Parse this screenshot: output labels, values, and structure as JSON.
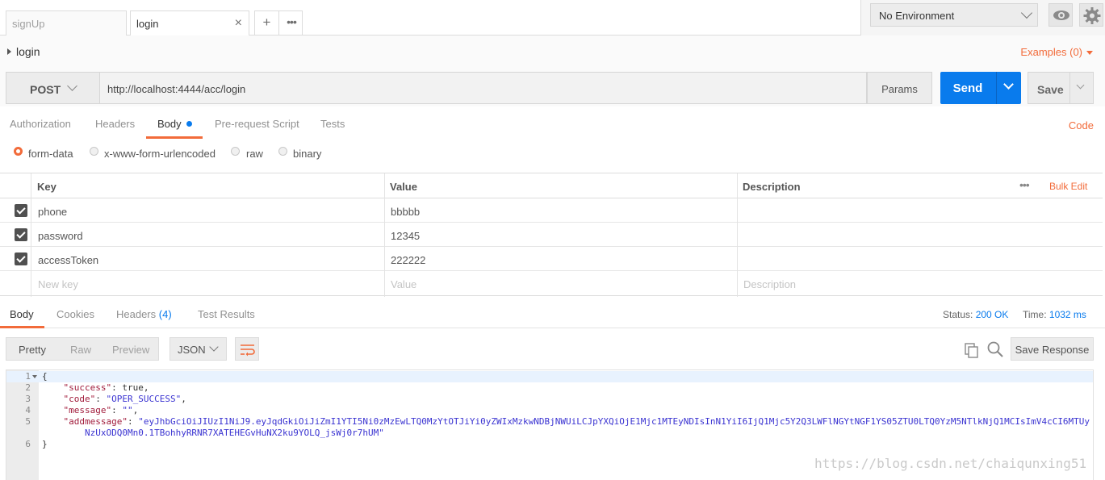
{
  "tabs": [
    {
      "label": "signUp"
    },
    {
      "label": "login"
    }
  ],
  "tab_close_glyph": "×",
  "tab_add_glyph": "+",
  "tab_more_glyph": "•••",
  "environment": {
    "selected": "No Environment"
  },
  "request": {
    "name": "login",
    "examples_label": "Examples (0)",
    "method": "POST",
    "url": "http://localhost:4444/acc/login",
    "params_label": "Params",
    "send_label": "Send",
    "save_label": "Save"
  },
  "request_tabs": {
    "items": [
      "Authorization",
      "Headers",
      "Body",
      "Pre-request Script",
      "Tests"
    ],
    "active": "Body",
    "code_label": "Code"
  },
  "body_types": {
    "options": [
      "form-data",
      "x-www-form-urlencoded",
      "raw",
      "binary"
    ],
    "selected": "form-data"
  },
  "kv_table": {
    "headers": {
      "key": "Key",
      "value": "Value",
      "description": "Description"
    },
    "bulk_edit": "Bulk Edit",
    "more_glyph": "•••",
    "rows": [
      {
        "checked": true,
        "key": "phone",
        "value": "bbbbb",
        "description": ""
      },
      {
        "checked": true,
        "key": "password",
        "value": "12345",
        "description": ""
      },
      {
        "checked": true,
        "key": "accessToken",
        "value": "222222",
        "description": ""
      }
    ],
    "placeholder": {
      "key": "New key",
      "value": "Value",
      "description": "Description"
    }
  },
  "response_tabs": {
    "body": "Body",
    "cookies": "Cookies",
    "headers": "Headers",
    "headers_count": "(4)",
    "test_results": "Test Results",
    "active": "Body"
  },
  "response_status": {
    "status_label": "Status:",
    "status_value": "200 OK",
    "time_label": "Time:",
    "time_value": "1032 ms"
  },
  "response_toolbar": {
    "views": [
      "Pretty",
      "Raw",
      "Preview"
    ],
    "active_view": "Pretty",
    "format": "JSON",
    "save_response": "Save Response"
  },
  "response_body": {
    "line_numbers": [
      "1",
      "2",
      "3",
      "4",
      "5",
      "",
      "6"
    ],
    "open_brace": "{",
    "close_brace": "}",
    "success_key": "\"success\"",
    "success_value": "true",
    "code_key": "\"code\"",
    "code_value": "\"OPER_SUCCESS\"",
    "message_key": "\"message\"",
    "message_value": "\"\"",
    "addmessage_key": "\"addmessage\"",
    "addmessage_value_line1": "\"eyJhbGciOiJIUzI1NiJ9.eyJqdGkiOiJiZmI1YTI5Ni0zMzEwLTQ0MzYtOTJiYi0yZWIxMzkwNDBjNWUiLCJpYXQiOjE1Mjc1MTEyNDIsInN1YiI6IjQ1Mjc5Y2Q3LWFlNGYtNGF1YS05ZTU0LTQ0YzM5NTlkNjQ1MCIsImV4cCI6MTUy",
    "addmessage_value_line2": "NzUxODQ0Mn0.1TBohhyRRNR7XATEHEGvHuNX2ku9YOLQ_jsWj0r7hUM\""
  },
  "watermark": "https://blog.csdn.net/chaiqunxing51",
  "colors": {
    "accent": "#f26b3a",
    "primary": "#097bed",
    "json_key": "#a11b3b",
    "json_string": "#3a33d1"
  },
  "icons": [
    "eye-icon",
    "gear-icon",
    "copy-icon",
    "search-icon",
    "wrap-lines-icon",
    "chevron-down-icon",
    "caret-right-icon"
  ]
}
